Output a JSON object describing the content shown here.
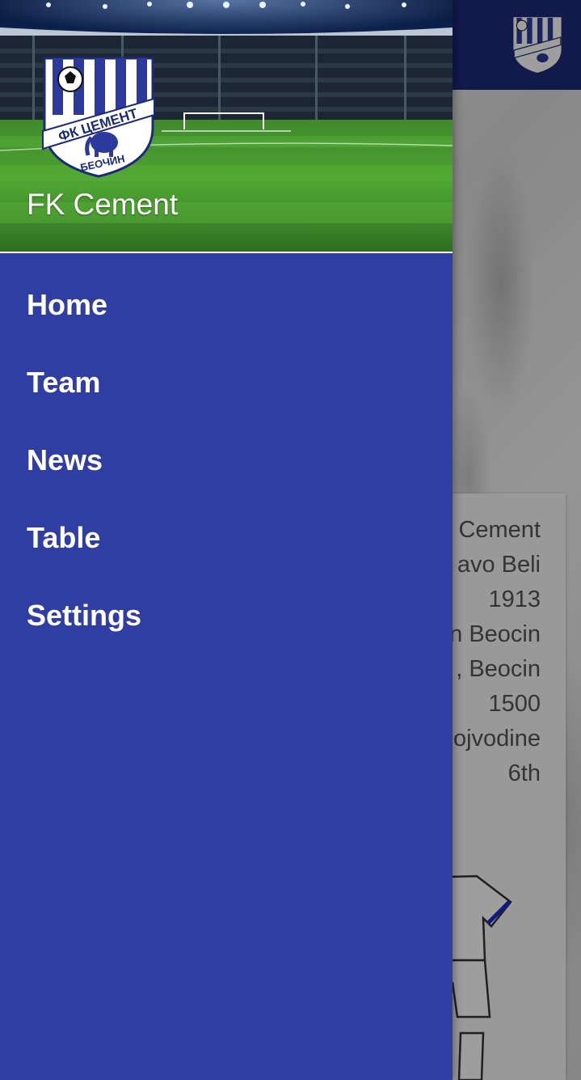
{
  "app": {
    "toolbar_color": "#1c2a78",
    "drawer_color": "#2f3ea0",
    "logo_icon": "fk-cement-crest-icon"
  },
  "drawer": {
    "header_title": "FK Cement",
    "header_image": "stadium-background",
    "items": [
      {
        "label": "Home"
      },
      {
        "label": "Team"
      },
      {
        "label": "News"
      },
      {
        "label": "Table"
      },
      {
        "label": "Settings"
      }
    ]
  },
  "background_content": {
    "info_lines": [
      "Cement",
      "avo Beli",
      "1913",
      "n Beocin",
      ", Beocin",
      "1500",
      "ojvodine",
      "6th"
    ]
  }
}
